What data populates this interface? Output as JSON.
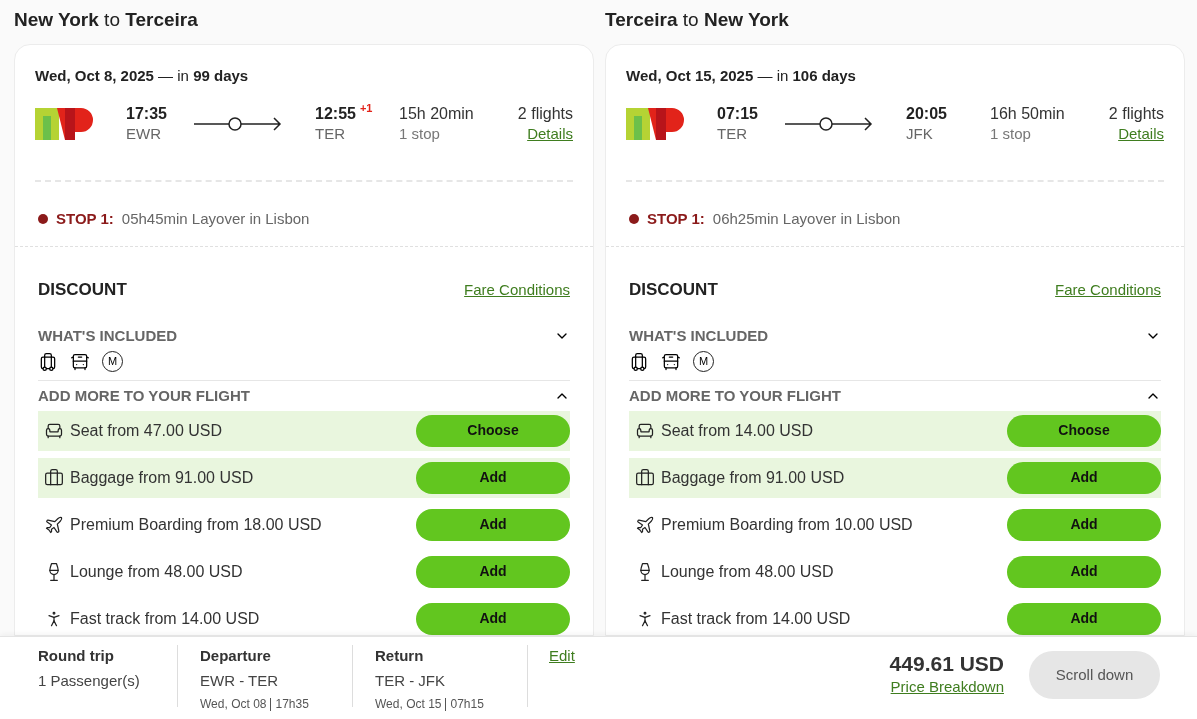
{
  "trips": [
    {
      "heading": "**New York** to **Terceira**",
      "date": "**Wed, Oct 8, 2025** — in **99 days**",
      "depart_time": "17:35",
      "depart_code": "EWR",
      "arrive_time": "12:55",
      "day_offset": "+1",
      "arrive_code": "TER",
      "duration": "15h 20min",
      "stops": "1 stop",
      "flights": "2 flights",
      "details_link": "Details",
      "stop_label": "STOP 1:",
      "stop_text": "05h45min Layover in Lisbon",
      "fare": "DISCOUNT",
      "fare_link": "Fare Conditions",
      "included": {
        "title": "WHAT'S INCLUDED",
        "expanded": false,
        "badge": "M"
      },
      "addons_title": "ADD MORE TO YOUR FLIGHT",
      "addons_expanded": true,
      "addons": [
        {
          "label": "Seat from 47.00 USD",
          "button": "Choose",
          "selected": true
        },
        {
          "label": "Baggage from 91.00 USD",
          "button": "Add",
          "selected": true
        },
        {
          "label": "Premium Boarding from 18.00 USD",
          "button": "Add",
          "selected": false
        },
        {
          "label": "Lounge from 48.00 USD",
          "button": "Add",
          "selected": false
        },
        {
          "label": "Fast track from 14.00 USD",
          "button": "Add",
          "selected": false
        }
      ]
    },
    {
      "heading": "**Terceira** to **New York**",
      "date": "**Wed, Oct 15, 2025** — in **106 days**",
      "depart_time": "07:15",
      "depart_code": "TER",
      "arrive_time": "20:05",
      "arrive_code": "JFK",
      "duration": "16h 50min",
      "stops": "1 stop",
      "flights": "2 flights",
      "details_link": "Details",
      "stop_label": "STOP 1:",
      "stop_text": "06h25min Layover in Lisbon",
      "fare": "DISCOUNT",
      "fare_link": "Fare Conditions",
      "included": {
        "title": "WHAT'S INCLUDED",
        "expanded": false,
        "badge": "M"
      },
      "addons_title": "ADD MORE TO YOUR FLIGHT",
      "addons_expanded": true,
      "addons": [
        {
          "label": "Seat from 14.00 USD",
          "button": "Choose",
          "selected": true
        },
        {
          "label": "Baggage from 91.00 USD",
          "button": "Add",
          "selected": true
        },
        {
          "label": "Premium Boarding from 10.00 USD",
          "button": "Add",
          "selected": false
        },
        {
          "label": "Lounge from 48.00 USD",
          "button": "Add",
          "selected": false
        },
        {
          "label": "Fast track from 14.00 USD",
          "button": "Add",
          "selected": false
        }
      ]
    }
  ],
  "footer": {
    "trip_type": "Round trip",
    "passengers": "1 Passenger(s)",
    "legs": [
      {
        "title": "Departure",
        "route": "EWR - TER",
        "date": "Wed, Oct 08",
        "time": "17h35"
      },
      {
        "title": "Return",
        "route": "TER - JFK",
        "date": "Wed, Oct 15",
        "time": "07h15"
      }
    ],
    "edit_link": "Edit",
    "total": "449.61 USD",
    "breakdown_link": "Price Breakdown",
    "scroll_button": "Scroll down"
  }
}
